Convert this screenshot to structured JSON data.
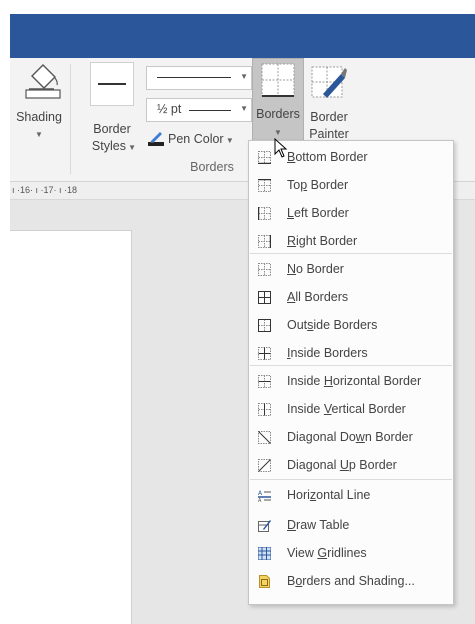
{
  "ribbon": {
    "shading_label": "Shading",
    "border_styles_line1": "Border",
    "border_styles_line2": "Styles",
    "pen_weight": "½ pt",
    "pen_color_label": "Pen Color",
    "borders_label": "Borders",
    "border_painter_line1": "Border",
    "border_painter_line2": "Painter",
    "group_label": "Borders"
  },
  "ruler": {
    "text": "ı ·16· ı ·17· ı ·18"
  },
  "menu": {
    "items": [
      {
        "pre": "",
        "key": "B",
        "post": "ottom Border",
        "icon": "bottom-border-icon"
      },
      {
        "pre": "To",
        "key": "p",
        "post": " Border",
        "icon": "top-border-icon"
      },
      {
        "pre": "",
        "key": "L",
        "post": "eft Border",
        "icon": "left-border-icon"
      },
      {
        "pre": "",
        "key": "R",
        "post": "ight Border",
        "icon": "right-border-icon"
      },
      {
        "pre": "",
        "key": "N",
        "post": "o Border",
        "icon": "no-border-icon"
      },
      {
        "pre": "",
        "key": "A",
        "post": "ll Borders",
        "icon": "all-borders-icon"
      },
      {
        "pre": "Out",
        "key": "s",
        "post": "ide Borders",
        "icon": "outside-borders-icon"
      },
      {
        "pre": "",
        "key": "I",
        "post": "nside Borders",
        "icon": "inside-borders-icon"
      },
      {
        "pre": "Inside ",
        "key": "H",
        "post": "orizontal Border",
        "icon": "inside-horizontal-border-icon"
      },
      {
        "pre": "Inside ",
        "key": "V",
        "post": "ertical Border",
        "icon": "inside-vertical-border-icon"
      },
      {
        "pre": "Diagonal Do",
        "key": "w",
        "post": "n Border",
        "icon": "diagonal-down-border-icon"
      },
      {
        "pre": "Diagonal ",
        "key": "U",
        "post": "p Border",
        "icon": "diagonal-up-border-icon"
      },
      {
        "pre": "Hori",
        "key": "z",
        "post": "ontal Line",
        "icon": "horizontal-line-icon"
      },
      {
        "pre": "",
        "key": "D",
        "post": "raw Table",
        "icon": "draw-table-icon"
      },
      {
        "pre": "View ",
        "key": "G",
        "post": "ridlines",
        "icon": "view-gridlines-icon"
      },
      {
        "pre": "B",
        "key": "o",
        "post": "rders and Shading...",
        "icon": "borders-and-shading-icon"
      }
    ]
  }
}
